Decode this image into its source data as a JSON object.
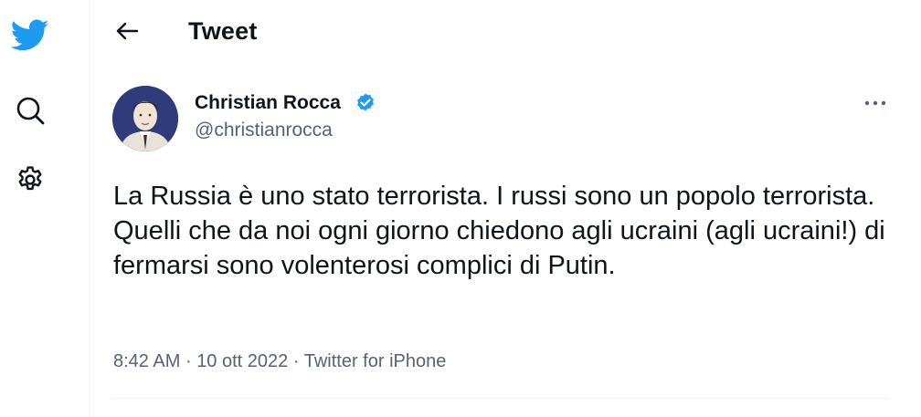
{
  "sidebar": {
    "items": [
      {
        "icon": "twitter-bird-icon"
      },
      {
        "icon": "search-icon"
      },
      {
        "icon": "gear-icon"
      }
    ],
    "brand_color": "#1d9bf0"
  },
  "header": {
    "back_icon": "arrow-left-icon",
    "title": "Tweet"
  },
  "tweet": {
    "author_name": "Christian Rocca",
    "handle": "@christianrocca",
    "verified": true,
    "text": "La Russia è uno stato terrorista. I russi sono un popolo terrorista. Quelli che da noi ogni giorno chiedono agli ucraini (agli ucraini!) di fermarsi sono volenterosi complici di Putin.",
    "time": "8:42 AM",
    "date": "10 ott 2022",
    "source": "Twitter for iPhone",
    "separator": "·"
  },
  "colors": {
    "text": "#0f1419",
    "secondary": "#536471",
    "verified": "#1d9bf0",
    "divider": "#eff3f4"
  }
}
